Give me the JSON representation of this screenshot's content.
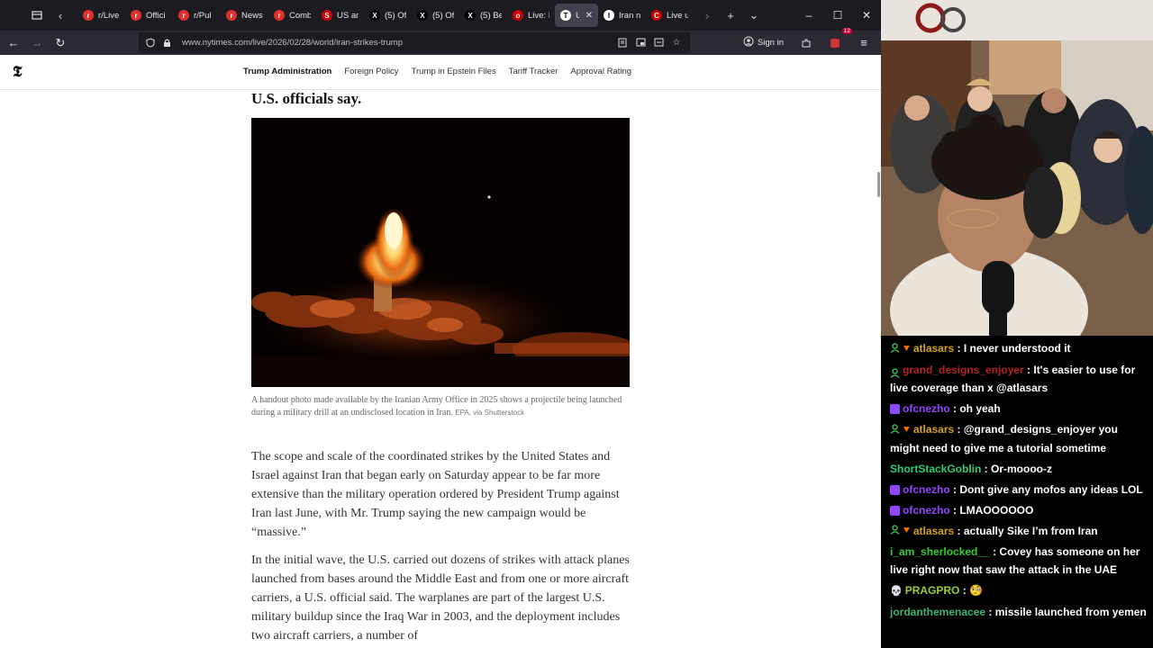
{
  "browser": {
    "tabs": [
      {
        "title": "r/Live",
        "fav_color": "#e0302d",
        "fav_glyph": "r"
      },
      {
        "title": "Offici",
        "fav_color": "#e0302d",
        "fav_glyph": "r"
      },
      {
        "title": "r/Pul",
        "fav_color": "#e0302d",
        "fav_glyph": "r"
      },
      {
        "title": "News",
        "fav_color": "#e0302d",
        "fav_glyph": "r"
      },
      {
        "title": "Comb",
        "fav_color": "#e0302d",
        "fav_glyph": "r"
      },
      {
        "title": "US an",
        "fav_color": "#cc0000",
        "fav_glyph": "S"
      },
      {
        "title": "(5) Of",
        "fav_color": "#000000",
        "fav_glyph": "X"
      },
      {
        "title": "(5) Of",
        "fav_color": "#000000",
        "fav_glyph": "X"
      },
      {
        "title": "(5) Be",
        "fav_color": "#000000",
        "fav_glyph": "X"
      },
      {
        "title": "Live: I",
        "fav_color": "#cc0000",
        "fav_glyph": "o"
      },
      {
        "title": "U.S",
        "fav_color": "#ffffff",
        "fav_glyph": "T",
        "active": true
      },
      {
        "title": "Iran n",
        "fav_color": "#ffffff",
        "fav_glyph": "I"
      },
      {
        "title": "Live u",
        "fav_color": "#cc0000",
        "fav_glyph": "C"
      }
    ],
    "url": "www.nytimes.com/live/2026/02/28/world/iran-strikes-trump",
    "signin_label": "Sign in",
    "extensions_badge": "12"
  },
  "site": {
    "nav_links": [
      "Trump Administration",
      "Foreign Policy",
      "Trump in Epstein Files",
      "Tariff Tracker",
      "Approval Rating"
    ]
  },
  "article": {
    "headline_fragment": "U.S. officials say.",
    "caption_text": "A handout photo made available by the Iranian Army Office in 2025 shows a projectile being launched during a military drill at an undisclosed location in Iran.",
    "caption_credit": "EPA, via Shutterstock",
    "paragraph_1": "The scope and scale of the coordinated strikes by the United States and Israel against Iran that began early on Saturday appear to be far more extensive than the military operation ordered by President Trump against Iran last June, with Mr. Trump saying the new campaign would be “massive.”",
    "paragraph_2": "In the initial wave, the U.S. carried out dozens of strikes with attack planes launched from bases around the Middle East and from one or more aircraft carriers, a U.S. official said. The warplanes are part of the largest U.S. military buildup since the Iraq War in 2003, and the deployment includes two aircraft carriers, a number of"
  },
  "chat": {
    "messages": [
      {
        "badges": [
          "user",
          "mod"
        ],
        "name": "atlasars",
        "color": "#d4a017",
        "text": "I never understood it"
      },
      {
        "badges": [
          "user"
        ],
        "name": "grand_designs_enjoyer",
        "color": "#b22222",
        "text": "It's easier to use for live coverage than x @atlasars"
      },
      {
        "badges": [
          "sq"
        ],
        "name": "ofcnezho",
        "color": "#9147ff",
        "text": "oh yeah"
      },
      {
        "badges": [
          "user",
          "mod"
        ],
        "name": "atlasars",
        "color": "#d4a017",
        "text": "@grand_designs_enjoyer you might need to give me a tutorial sometime"
      },
      {
        "badges": [],
        "name": "ShortStackGoblin",
        "color": "#2ecc71",
        "text": "Or-moooo-z"
      },
      {
        "badges": [
          "sq"
        ],
        "name": "ofcnezho",
        "color": "#9147ff",
        "text": "Dont give any mofos any ideas LOL"
      },
      {
        "badges": [
          "sq"
        ],
        "name": "ofcnezho",
        "color": "#9147ff",
        "text": "LMAOOOOOO"
      },
      {
        "badges": [
          "user",
          "mod"
        ],
        "name": "atlasars",
        "color": "#d4a017",
        "text": "actually Sike I’m from Iran"
      },
      {
        "badges": [],
        "name": "i_am_sherlocked__",
        "color": "#32cd32",
        "text": "Covey has someone on her live right now that saw the attack in the UAE"
      },
      {
        "badges": [
          "skull"
        ],
        "name": "PRAGPRO",
        "color": "#9acd32",
        "text": "🧐"
      },
      {
        "badges": [],
        "name": "jordanthemenacee",
        "color": "#3cb371",
        "text": "missile launched from yemen"
      }
    ]
  }
}
